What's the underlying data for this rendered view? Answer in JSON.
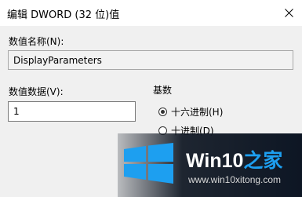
{
  "window": {
    "title": "编辑 DWORD (32 位)值"
  },
  "value_name": {
    "label": "数值名称(N):",
    "value": "DisplayParameters"
  },
  "value_data": {
    "label": "数值数据(V):",
    "value": "1"
  },
  "base": {
    "label": "基数",
    "options": [
      {
        "label": "十六进制(H)",
        "checked": true
      },
      {
        "label": "十进制(D)",
        "checked": false
      }
    ]
  },
  "watermark": {
    "brand_main": "Win10",
    "brand_accent": "之家",
    "url": "www.win10xitong.com",
    "logo_color": "#1d9ff0"
  },
  "icons": {
    "close": "close-icon",
    "radio": "radio-icon",
    "logo": "windows-logo-icon"
  }
}
